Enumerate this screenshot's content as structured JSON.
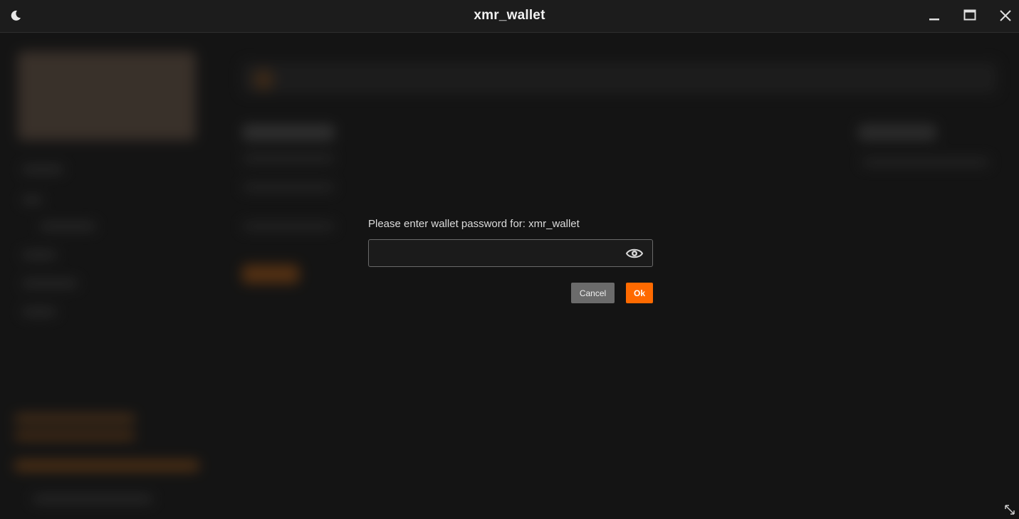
{
  "window": {
    "title": "xmr_wallet",
    "icons": {
      "theme": "moon-icon",
      "minimize": "minimize-icon",
      "maximize": "maximize-icon",
      "close": "close-icon",
      "resize": "resize-icon"
    }
  },
  "dialog": {
    "prompt": "Please enter wallet password for: xmr_wallet",
    "password_value": "",
    "password_placeholder": "",
    "toggle_visibility_icon": "eye-icon",
    "cancel_label": "Cancel",
    "ok_label": "Ok"
  },
  "colors": {
    "accent": "#ff6a00",
    "cancel_button": "#6b6b6b",
    "background": "#161616",
    "titlebar": "#1c1c1c"
  }
}
